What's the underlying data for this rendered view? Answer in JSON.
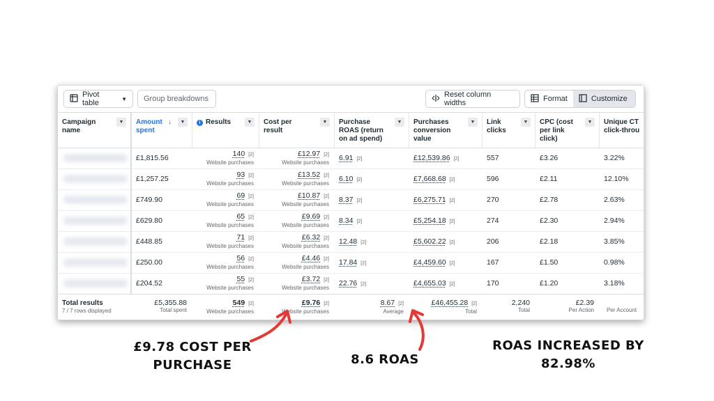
{
  "toolbar": {
    "pivot_label": "Pivot table",
    "group_label": "Group breakdowns",
    "reset_label": "Reset column widths",
    "format_label": "Format",
    "customize_label": "Customize"
  },
  "columns": [
    "Campaign name",
    "Amount spent",
    "Results",
    "Cost per result",
    "Purchase ROAS (return on ad spend)",
    "Purchases conversion value",
    "Link clicks",
    "CPC (cost per link click)",
    "Unique CT click-throu"
  ],
  "rows": [
    {
      "amount": "£1,815.56",
      "results": "140",
      "cpr": "£12.97",
      "roas": "6.91",
      "value": "£12,539.86",
      "clicks": "557",
      "cpc": "£3.26",
      "ctr": "3.22%"
    },
    {
      "amount": "£1,257.25",
      "results": "93",
      "cpr": "£13.52",
      "roas": "6.10",
      "value": "£7,668.68",
      "clicks": "596",
      "cpc": "£2.11",
      "ctr": "12.10%"
    },
    {
      "amount": "£749.90",
      "results": "69",
      "cpr": "£10.87",
      "roas": "8.37",
      "value": "£6,275.71",
      "clicks": "270",
      "cpc": "£2.78",
      "ctr": "2.63%"
    },
    {
      "amount": "£629.80",
      "results": "65",
      "cpr": "£9.69",
      "roas": "8.34",
      "value": "£5,254.18",
      "clicks": "274",
      "cpc": "£2.30",
      "ctr": "2.94%"
    },
    {
      "amount": "£448.85",
      "results": "71",
      "cpr": "£6.32",
      "roas": "12.48",
      "value": "£5,602.22",
      "clicks": "206",
      "cpc": "£2.18",
      "ctr": "3.85%"
    },
    {
      "amount": "£250.00",
      "results": "56",
      "cpr": "£4.46",
      "roas": "17.84",
      "value": "£4,459.60",
      "clicks": "167",
      "cpc": "£1.50",
      "ctr": "0.98%"
    },
    {
      "amount": "£204.52",
      "results": "55",
      "cpr": "£3.72",
      "roas": "22.76",
      "value": "£4,655.03",
      "clicks": "170",
      "cpc": "£1.20",
      "ctr": "3.18%"
    }
  ],
  "result_sub": "Website purchases",
  "note_tag": "[2]",
  "totals": {
    "label": "Total results",
    "rows_displayed": "7 / 7 rows displayed",
    "amount": "£5,355.88",
    "amount_sub": "Total spent",
    "results": "549",
    "results_sub": "Website purchases",
    "cpr": "£9.76",
    "cpr_sub": "Website purchases",
    "roas": "8.67",
    "roas_sub": "Average",
    "value": "£46,455.28",
    "value_sub": "Total",
    "clicks": "2,240",
    "clicks_sub": "Total",
    "cpc": "£2.39",
    "cpc_sub": "Per Action",
    "ctr_sub": "Per Account"
  },
  "annotations": {
    "cost_line1": "£9.78 COST PER",
    "cost_line2": "PURCHASE",
    "roas": "8.6 ROAS",
    "increase_line1": "ROAS INCREASED BY",
    "increase_line2": "82.98%"
  },
  "colors": {
    "accent": "#1877f2",
    "arrow": "#e53935"
  }
}
